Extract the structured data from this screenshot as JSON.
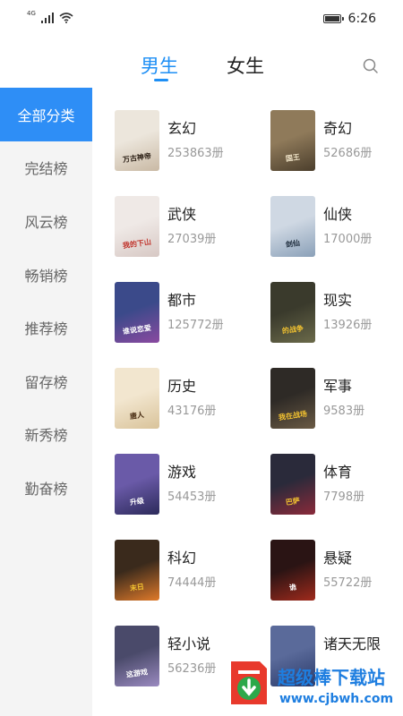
{
  "status": {
    "network": "4G",
    "time": "6:26"
  },
  "tabs": [
    {
      "label": "男生"
    },
    {
      "label": "女生"
    }
  ],
  "sidebar": {
    "items": [
      {
        "label": "全部分类"
      },
      {
        "label": "完结榜"
      },
      {
        "label": "风云榜"
      },
      {
        "label": "畅销榜"
      },
      {
        "label": "推荐榜"
      },
      {
        "label": "留存榜"
      },
      {
        "label": "新秀榜"
      },
      {
        "label": "勤奋榜"
      }
    ]
  },
  "categories": [
    {
      "name": "玄幻",
      "count": "253863册",
      "cover": {
        "title": "万古神帝",
        "bg": "#ece6dc",
        "fg": "#2a1e14",
        "shade": "#c9b9a4"
      }
    },
    {
      "name": "奇幻",
      "count": "52686册",
      "cover": {
        "title": "国王",
        "bg": "#8f7a5a",
        "fg": "#f0e4c8",
        "shade": "#4b3e2c"
      }
    },
    {
      "name": "武侠",
      "count": "27039册",
      "cover": {
        "title": "我的下山",
        "bg": "#efe9e6",
        "fg": "#c0322a",
        "shade": "#d7c8c4"
      }
    },
    {
      "name": "仙侠",
      "count": "17000册",
      "cover": {
        "title": "剑仙",
        "bg": "#cfd8e3",
        "fg": "#1c2a3a",
        "shade": "#8aa0b8"
      }
    },
    {
      "name": "都市",
      "count": "125772册",
      "cover": {
        "title": "谁说恋爱",
        "bg": "#3b4a8a",
        "fg": "#ffffff",
        "shade": "#8a4aa0"
      }
    },
    {
      "name": "现实",
      "count": "13926册",
      "cover": {
        "title": "的战争",
        "bg": "#3a3a2c",
        "fg": "#f2c230",
        "shade": "#6b6a4a"
      }
    },
    {
      "name": "历史",
      "count": "43176册",
      "cover": {
        "title": "唐人",
        "bg": "#f2e6cf",
        "fg": "#4a2e14",
        "shade": "#d9c39a"
      }
    },
    {
      "name": "军事",
      "count": "9583册",
      "cover": {
        "title": "我在战场",
        "bg": "#2e2a26",
        "fg": "#f2c230",
        "shade": "#6a5a44"
      }
    },
    {
      "name": "游戏",
      "count": "54453册",
      "cover": {
        "title": "升级",
        "bg": "#6a5aa8",
        "fg": "#ffffff",
        "shade": "#2c2a5a"
      }
    },
    {
      "name": "体育",
      "count": "7798册",
      "cover": {
        "title": "巴萨",
        "bg": "#2a2a3a",
        "fg": "#f2c230",
        "shade": "#8a2a3a"
      }
    },
    {
      "name": "科幻",
      "count": "74444册",
      "cover": {
        "title": "末日",
        "bg": "#3a2a1c",
        "fg": "#f2c230",
        "shade": "#e07a2a"
      }
    },
    {
      "name": "悬疑",
      "count": "55722册",
      "cover": {
        "title": "诡",
        "bg": "#2a1414",
        "fg": "#ffffff",
        "shade": "#a02a1c"
      }
    },
    {
      "name": "轻小说",
      "count": "56236册",
      "cover": {
        "title": "这游戏",
        "bg": "#4a4a6a",
        "fg": "#ffffff",
        "shade": "#9a8ac0"
      }
    },
    {
      "name": "诸天无限",
      "count": "",
      "cover": {
        "title": "",
        "bg": "#5a6a9a",
        "fg": "#ffffff",
        "shade": "#2a3a6a"
      }
    }
  ],
  "watermark": {
    "title": "超级棒下载站",
    "url": "www.cjbwh.com"
  },
  "colors": {
    "accent": "#1e8ff5",
    "sidebar_active": "#2e8ef6",
    "sidebar_bg": "#f4f4f4"
  }
}
